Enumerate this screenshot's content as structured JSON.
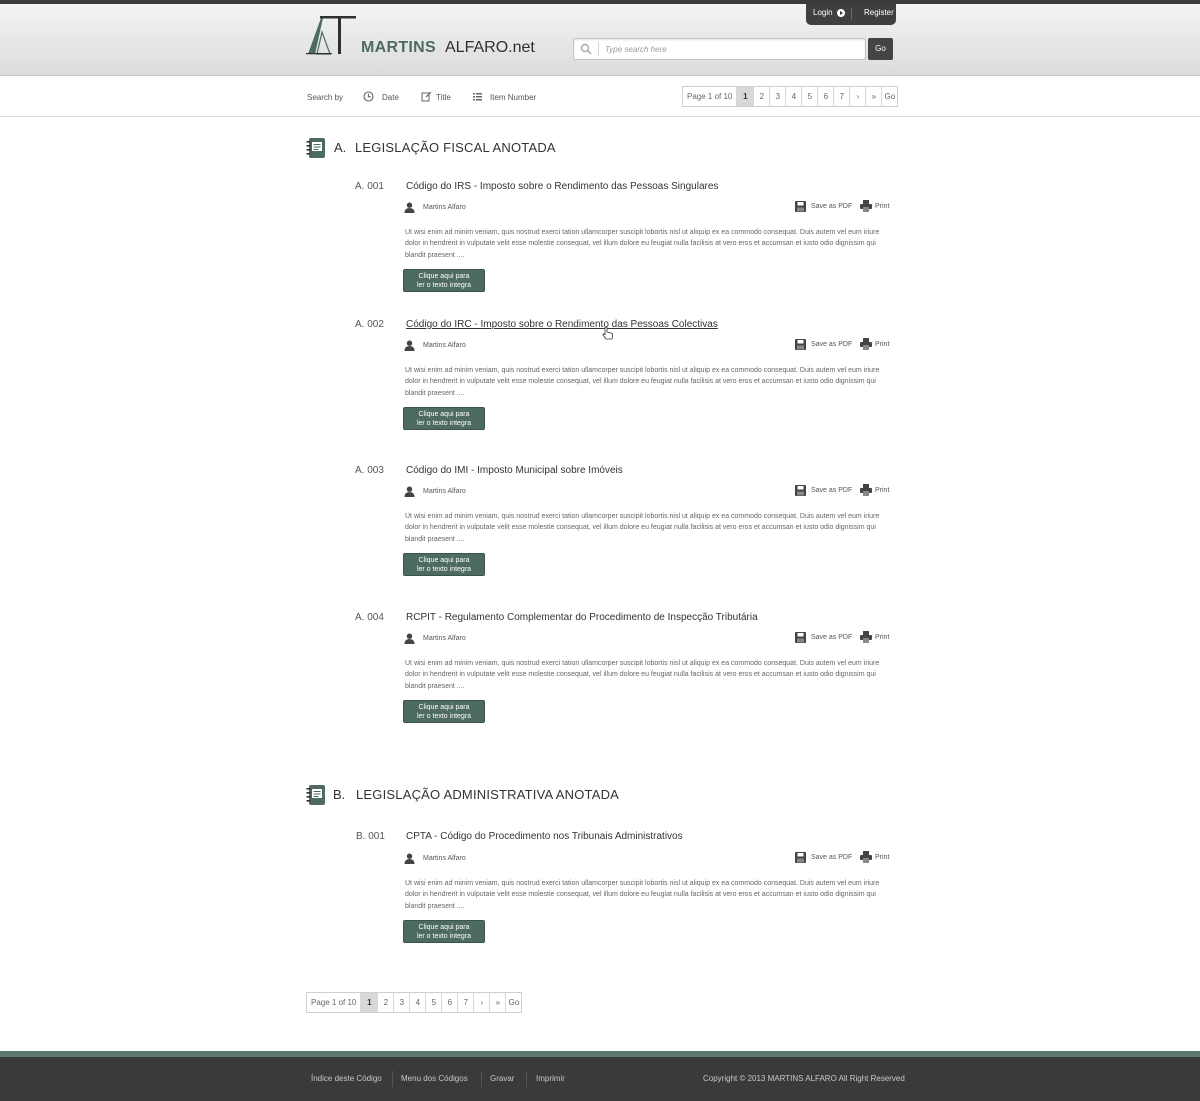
{
  "header": {
    "logo_martins": "MARTINS",
    "logo_alfaro": "ALFARO.net",
    "login": "Login",
    "register": "Register",
    "search_placeholder": "Type search here",
    "search_go": "Go"
  },
  "filter": {
    "label": "Search by",
    "date": "Date",
    "title": "Title",
    "item_number": "Item Number"
  },
  "pager": {
    "info": "Page 1 of 10",
    "pages": [
      "1",
      "2",
      "3",
      "4",
      "5",
      "6",
      "7"
    ],
    "next": "›",
    "last": "»",
    "go": "Go"
  },
  "sections": [
    {
      "letter": "A.",
      "title": "LEGISLAÇÃO FISCAL ANOTADA",
      "entries": [
        {
          "code": "A. 001",
          "title": "Código do IRS - Imposto sobre o Rendimento das Pessoas Singulares"
        },
        {
          "code": "A. 002",
          "title": "Código do IRC - Imposto sobre o Rendimento das Pessoas Colectivas"
        },
        {
          "code": "A. 003",
          "title": "Código do IMI - Imposto Municipal sobre Imóveis"
        },
        {
          "code": "A. 004",
          "title": "RCPIT - Regulamento Complementar do Procedimento de Inspecção Tributária"
        }
      ]
    },
    {
      "letter": "B.",
      "title": "LEGISLAÇÃO ADMINISTRATIVA ANOTADA",
      "entries": [
        {
          "code": "B. 001",
          "title": "CPTA - Código do Procedimento nos Tribunais Administrativos"
        }
      ]
    }
  ],
  "entry_common": {
    "author": "Martins Alfaro",
    "save_pdf": "Save as PDF",
    "print": "Print",
    "body": "Ut wisi enim ad minim veniam, quis nostrud exerci tation ullamcorper suscipit lobortis nisl ut aliquip ex ea commodo consequat. Duis autem vel eum iriure dolor in hendrerit in vulputate velit esse molestie consequat, vel illum dolore eu feugiat nulla facilisis at vero eros et accumsan et iusto odio dignissim qui blandit praesent ....",
    "button_line1": "Clique aqui para",
    "button_line2": "ler o texto integra"
  },
  "footer": {
    "links": [
      "Índice deste Código",
      "Menu dos Códigos",
      "Gravar",
      "Imprimir"
    ],
    "copyright": "Copyright © 2013 MARTINS ALFARO All Right Reserved"
  },
  "colors": {
    "accent": "#4d6b63",
    "footer_bg": "#3a3a3a",
    "footer_accent": "#5b776f"
  }
}
